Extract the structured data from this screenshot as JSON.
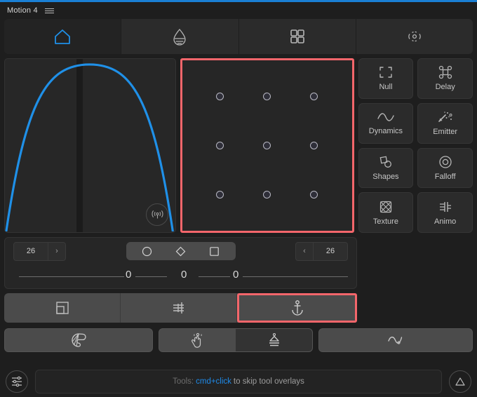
{
  "window": {
    "title": "Motion 4",
    "menu_icon": "hamburger-icon",
    "accent_color": "#1a7fd4",
    "highlight_color": "#f4666b"
  },
  "tabs": [
    {
      "icon": "home-icon",
      "name": "tab-home",
      "active": true
    },
    {
      "icon": "drop-icon",
      "name": "tab-drop",
      "active": false
    },
    {
      "icon": "grid-icon",
      "name": "tab-grid",
      "active": false
    },
    {
      "icon": "target-icon",
      "name": "tab-target",
      "active": false
    }
  ],
  "curve_panel": {
    "name": "curve-preview",
    "curve_color": "#1f90e8",
    "signal_button_icon": "signal-icon"
  },
  "anchor_grid": {
    "name": "anchor-point-grid",
    "rows": 3,
    "columns": 3,
    "selected": false,
    "highlighted": true,
    "points": [
      "anchor-top-left",
      "anchor-top-center",
      "anchor-top-right",
      "anchor-middle-left",
      "anchor-middle-center",
      "anchor-middle-right",
      "anchor-bottom-left",
      "anchor-bottom-center",
      "anchor-bottom-right"
    ]
  },
  "tools": [
    {
      "label": "Null",
      "icon": "null-brackets-icon"
    },
    {
      "label": "Delay",
      "icon": "command-icon"
    },
    {
      "label": "Dynamics",
      "icon": "wave-icon"
    },
    {
      "label": "Emitter",
      "icon": "particles-icon"
    },
    {
      "label": "Shapes",
      "icon": "shapes-icon"
    },
    {
      "label": "Falloff",
      "icon": "concentric-circles-icon"
    },
    {
      "label": "Texture",
      "icon": "crosshatch-icon"
    },
    {
      "label": "Animo",
      "icon": "animo-icon"
    }
  ],
  "controls": {
    "left_stepper": {
      "value": "26",
      "arrow": "›",
      "name": "left-value-stepper"
    },
    "right_stepper": {
      "value": "26",
      "arrow": "‹",
      "name": "right-value-stepper"
    },
    "shape_toggles": [
      {
        "icon": "circle-icon",
        "name": "shape-circle"
      },
      {
        "icon": "diamond-icon",
        "name": "shape-diamond"
      },
      {
        "icon": "square-icon",
        "name": "shape-square"
      }
    ],
    "sliders": [
      {
        "name": "slider-left",
        "value": "0"
      },
      {
        "name": "slider-center",
        "value": "0"
      },
      {
        "name": "slider-right",
        "value": "0"
      }
    ]
  },
  "bottom_tabs": [
    {
      "icon": "layout-icon",
      "name": "bottom-tab-layout",
      "selected": false
    },
    {
      "icon": "align-icon",
      "name": "bottom-tab-align",
      "selected": false
    },
    {
      "icon": "anchor-icon",
      "name": "bottom-tab-anchor",
      "selected": true
    }
  ],
  "actions": {
    "palette": {
      "icon": "palette-icon",
      "name": "action-palette"
    },
    "segment": [
      {
        "icon": "hand-icon",
        "name": "action-hand",
        "active": false
      },
      {
        "icon": "stack-icon",
        "name": "action-stack",
        "active": true
      }
    ],
    "curve": {
      "icon": "curve-icon",
      "name": "action-curve"
    }
  },
  "status": {
    "settings_icon": "sliders-icon",
    "prefix": "Tools:",
    "shortcut": "cmd+click",
    "suffix": "to skip tool overlays",
    "triangle_icon": "triangle-icon"
  }
}
